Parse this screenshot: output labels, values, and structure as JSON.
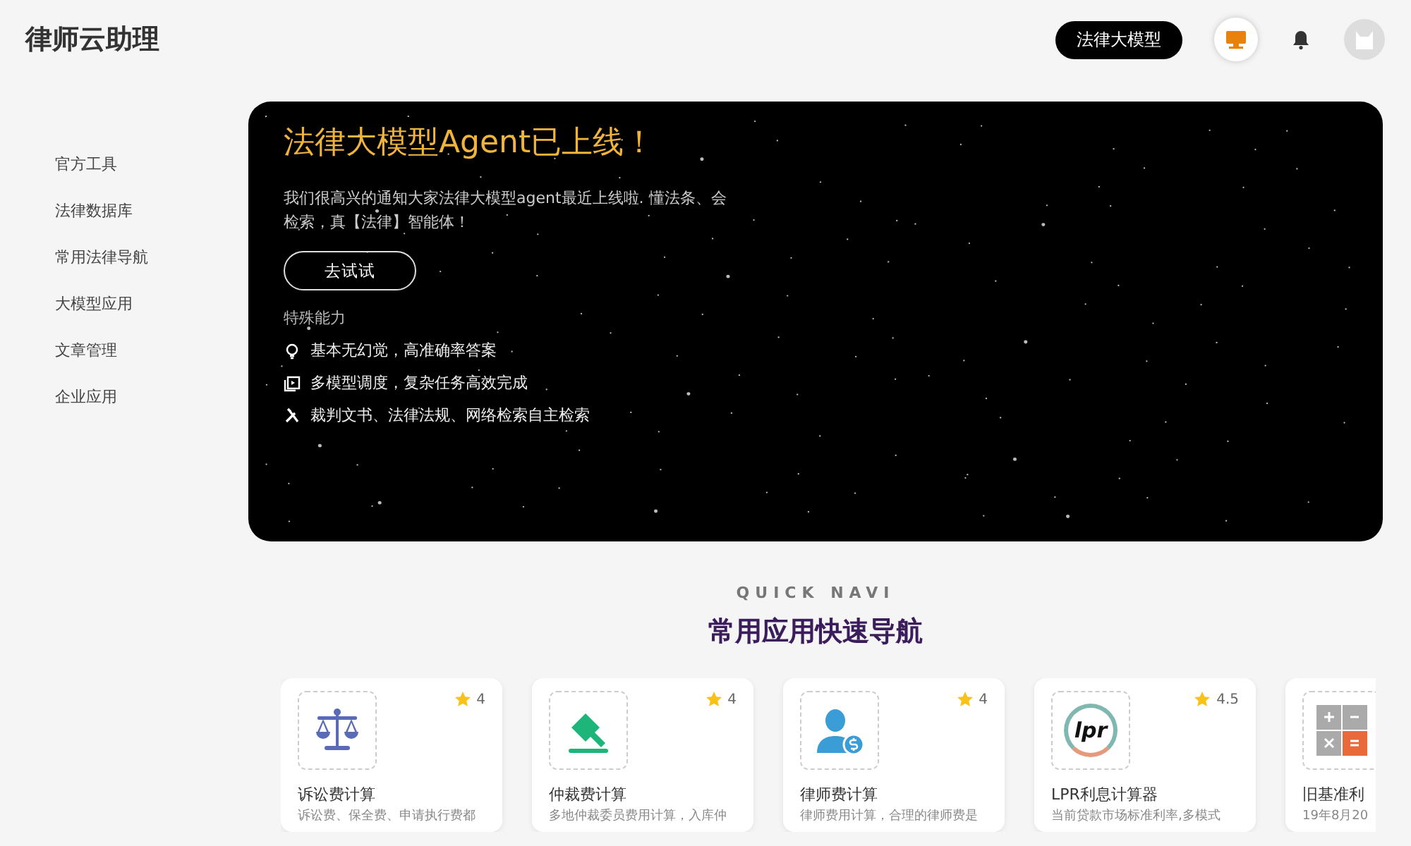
{
  "header": {
    "logo": "律师云助理",
    "model_button": "法律大模型"
  },
  "sidebar": {
    "items": [
      {
        "label": "官方工具"
      },
      {
        "label": "法律数据库"
      },
      {
        "label": "常用法律导航"
      },
      {
        "label": "大模型应用"
      },
      {
        "label": "文章管理"
      },
      {
        "label": "企业应用"
      }
    ]
  },
  "banner": {
    "title": "法律大模型Agent已上线！",
    "description": "我们很高兴的通知大家法律大模型agent最近上线啦. 懂法条、会检索，真【法律】智能体！",
    "button": "去试试",
    "features_title": "特殊能力",
    "features": [
      {
        "kind": "bulb",
        "text": "基本无幻觉，高准确率答案"
      },
      {
        "kind": "layers",
        "text": "多模型调度，复杂任务高效完成"
      },
      {
        "kind": "tools",
        "text": "裁判文书、法律法规、网络检索自主检索"
      }
    ]
  },
  "quick_navi": {
    "eyebrow": "QUICK NAVI",
    "title": "常用应用快速导航",
    "cards": [
      {
        "kind": "scale",
        "rating": "4",
        "title": "诉讼费计算",
        "description": "诉讼费、保全费、申请执行费都"
      },
      {
        "kind": "gavel",
        "rating": "4",
        "title": "仲裁费计算",
        "description": "多地仲裁委员费用计算，入库仲"
      },
      {
        "kind": "lawyer",
        "rating": "4",
        "title": "律师费计算",
        "description": "律师费用计算，合理的律师费是"
      },
      {
        "kind": "lpr",
        "icon_text": "lpr",
        "rating": "4.5",
        "title": "LPR利息计算器",
        "description": "当前贷款市场标准利率,多模式"
      },
      {
        "kind": "calculator",
        "title": "旧基准利",
        "description": "19年8月20"
      }
    ]
  }
}
